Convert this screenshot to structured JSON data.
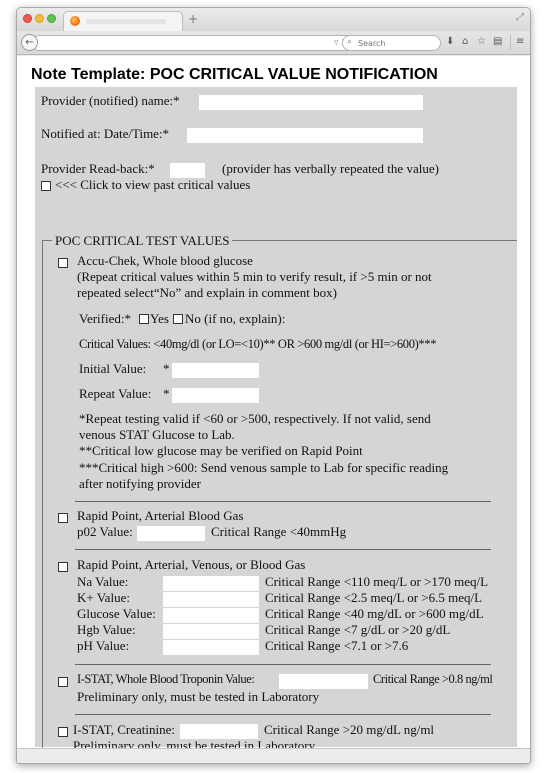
{
  "browser": {
    "new_tab": "+",
    "search_placeholder": "Search"
  },
  "page": {
    "title": "Note Template: POC CRITICAL VALUE NOTIFICATION",
    "provider_name_label": "Provider (notified) name:*",
    "notified_at_label": "Notified at: Date/Time:*",
    "readback_label": "Provider Read-back:*",
    "readback_note": "(provider has verbally repeated the value)",
    "past_values_link": "<<< Click to view past critical values",
    "section_legend": "POC CRITICAL TEST VALUES"
  },
  "accu_chek": {
    "title": "Accu-Chek, Whole blood glucose",
    "instructions_1": "(Repeat critical values within 5 min to verify result, if >5 min or not",
    "instructions_2": "repeated select“No” and explain in comment box)",
    "verified_label": "Verified:*",
    "yes_label": "Yes",
    "no_label": "No (if no, explain):",
    "critical_values": "Critical Values: <40mg/dl (or LO=<10)** OR >600 mg/dl (or HI=>600)***",
    "initial_label": "Initial Value:",
    "initial_star": "*",
    "repeat_label": "Repeat Value:",
    "repeat_star": "*",
    "note_1a": "*Repeat testing valid if <60 or >500, respectively. If not valid, send",
    "note_1b": "venous STAT Glucose to Lab.",
    "note_2": "**Critical low glucose may be verified on Rapid Point",
    "note_3a": "***Critical high >600: Send venous sample to Lab for specific reading",
    "note_3b": "after notifying provider"
  },
  "rapid_arterial": {
    "title": "Rapid Point, Arterial Blood Gas",
    "p02_label": "p02 Value:",
    "p02_range": "Critical Range <40mmHg"
  },
  "rapid_gas": {
    "title": "Rapid Point, Arterial, Venous, or Blood Gas",
    "rows": [
      {
        "label": "Na Value:",
        "range": "Critical Range <110 meq/L or >170 meq/L"
      },
      {
        "label": "K+ Value:",
        "range": "Critical Range <2.5 meq/L or >6.5 meq/L"
      },
      {
        "label": "Glucose Value:",
        "range": "Critical Range <40 mg/dL or >600 mg/dL"
      },
      {
        "label": "Hgb Value:",
        "range": "Critical Range <7 g/dL or >20 g/dL"
      },
      {
        "label": "pH Value:",
        "range": "Critical Range <7.1 or >7.6"
      }
    ]
  },
  "istat_troponin": {
    "label": "I-STAT, Whole Blood Troponin Value:",
    "range": "Critical Range >0.8 ng/ml",
    "note": "Preliminary only, must be tested in Laboratory"
  },
  "istat_creatinine": {
    "label": "I-STAT, Creatinine:",
    "range": "Critical Range >20 mg/dL ng/ml",
    "note": "Preliminary only, must be tested in Laboratory"
  }
}
